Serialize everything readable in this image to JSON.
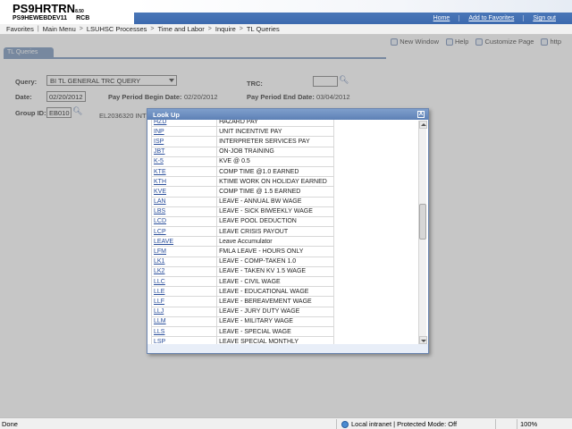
{
  "header": {
    "title": "PS9HRTRN",
    "version": "8.50",
    "subtitle": "PS9HEWEBDEV11",
    "user_code": "RCB",
    "links": [
      "Home",
      "Add to Favorites",
      "Sign out"
    ]
  },
  "menu": {
    "items": [
      "Favorites",
      "Main Menu",
      "LSUHSC Processes",
      "Time and Labor",
      "Inquire",
      "TL Queries"
    ],
    "separator": ">"
  },
  "toolbar": {
    "new_window": "New Window",
    "help": "Help",
    "customize": "Customize Page",
    "http": "http"
  },
  "tab": {
    "label": "TL Queries"
  },
  "form": {
    "query_label": "Query:",
    "query_value": "BI TL GENERAL TRC QUERY",
    "trc_label": "TRC:",
    "trc_value": "",
    "date_label": "Date:",
    "date_value": "02/20/2012",
    "pp_begin_label": "Pay Period Begin Date:",
    "pp_begin_value": "02/20/2012",
    "pp_end_label": "Pay Period End Date:",
    "pp_end_value": "03/04/2012",
    "group_label": "Group ID:",
    "group_value": "EB010",
    "group_desc": "EL2036320 INT"
  },
  "modal": {
    "title": "Look Up",
    "close": "X",
    "rows": [
      {
        "code": "HZD",
        "desc": "HAZARD PAY"
      },
      {
        "code": "INP",
        "desc": "UNIT INCENTIVE PAY"
      },
      {
        "code": "ISP",
        "desc": "INTERPRETER SERVICES PAY"
      },
      {
        "code": "JBT",
        "desc": "ON-JOB TRAINING"
      },
      {
        "code": "K-5",
        "desc": "KVE @ 0.5"
      },
      {
        "code": "KTE",
        "desc": "COMP TIME @1.0 EARNED"
      },
      {
        "code": "KTH",
        "desc": "KTIME WORK ON HOLIDAY EARNED"
      },
      {
        "code": "KVE",
        "desc": "COMP TIME @ 1.5 EARNED"
      },
      {
        "code": "LAN",
        "desc": "LEAVE - ANNUAL BW WAGE"
      },
      {
        "code": "LBS",
        "desc": "LEAVE - SICK BIWEEKLY WAGE"
      },
      {
        "code": "LCD",
        "desc": "LEAVE POOL DEDUCTION"
      },
      {
        "code": "LCP",
        "desc": "LEAVE CRISIS PAYOUT"
      },
      {
        "code": "LEAVE",
        "desc": "Leave Accumulator"
      },
      {
        "code": "LFM",
        "desc": "FMLA LEAVE - HOURS ONLY"
      },
      {
        "code": "LK1",
        "desc": "LEAVE -  COMP-TAKEN 1.0"
      },
      {
        "code": "LK2",
        "desc": "LEAVE - TAKEN KV 1.5 WAGE"
      },
      {
        "code": "LLC",
        "desc": "LEAVE - CIVIL WAGE"
      },
      {
        "code": "LLE",
        "desc": "LEAVE - EDUCATIONAL WAGE"
      },
      {
        "code": "LLF",
        "desc": "LEAVE - BEREAVEMENT WAGE"
      },
      {
        "code": "LLJ",
        "desc": "LEAVE - JURY DUTY WAGE"
      },
      {
        "code": "LLM",
        "desc": "LEAVE - MILITARY WAGE"
      },
      {
        "code": "LLS",
        "desc": "LEAVE - SPECIAL WAGE"
      },
      {
        "code": "LSP",
        "desc": "LEAVE SPECIAL MONTHLY"
      }
    ]
  },
  "status": {
    "left": "Done",
    "zone": "Local intranet | Protected Mode: Off",
    "zoom": "100%"
  }
}
